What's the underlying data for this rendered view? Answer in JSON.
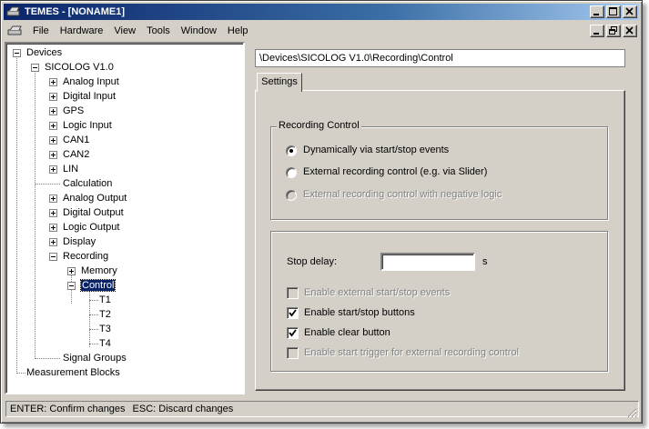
{
  "window": {
    "title": "TEMES - [NONAME1]"
  },
  "menu": [
    "File",
    "Hardware",
    "View",
    "Tools",
    "Window",
    "Help"
  ],
  "tree": {
    "root": "Devices",
    "device": "SICOLOG V1.0",
    "channels": [
      "Analog Input",
      "Digital Input",
      "GPS",
      "Logic Input",
      "CAN1",
      "CAN2",
      "LIN"
    ],
    "calculation": "Calculation",
    "outputs": [
      "Analog Output",
      "Digital Output",
      "Logic Output",
      "Display"
    ],
    "recording": "Recording",
    "memory": "Memory",
    "control": "Control",
    "triggers": [
      "T1",
      "T2",
      "T3",
      "T4"
    ],
    "signal_groups": "Signal Groups",
    "measurement_blocks": "Measurement Blocks"
  },
  "path": "\\Devices\\SICOLOG V1.0\\Recording\\Control",
  "tab": {
    "label": "Settings"
  },
  "recording_control": {
    "title": "Recording Control",
    "options": [
      {
        "label": "Dynamically via start/stop events",
        "checked": true,
        "enabled": true
      },
      {
        "label": "External recording control (e.g. via Slider)",
        "checked": false,
        "enabled": true
      },
      {
        "label": "External recording control with negative logic",
        "checked": false,
        "enabled": false
      }
    ]
  },
  "settings": {
    "stop_delay_label": "Stop delay:",
    "stop_delay_value": "",
    "stop_delay_unit": "s",
    "checkboxes": [
      {
        "label": "Enable external start/stop events",
        "checked": false,
        "enabled": false
      },
      {
        "label": "Enable start/stop buttons",
        "checked": true,
        "enabled": true
      },
      {
        "label": "Enable clear button",
        "checked": true,
        "enabled": true
      },
      {
        "label": "Enable start trigger for external recording control",
        "checked": false,
        "enabled": false
      }
    ]
  },
  "status": {
    "hint1": "ENTER: Confirm changes",
    "hint2": "ESC: Discard changes"
  }
}
